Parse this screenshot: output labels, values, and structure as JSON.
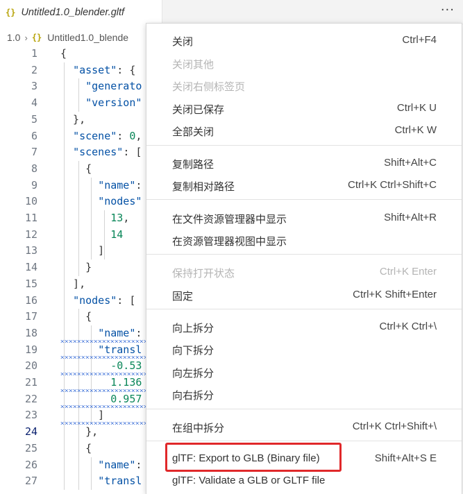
{
  "tab": {
    "icon": "{}",
    "title": "Untitled1.0_blender.gltf",
    "more": "···"
  },
  "breadcrumb": {
    "folder": "1.0",
    "chevron": "›",
    "icon": "{}",
    "file": "Untitled1.0_blende"
  },
  "editor": {
    "active_line": 24,
    "lines": [
      {
        "n": "1",
        "t": [
          [
            "p",
            "{"
          ]
        ]
      },
      {
        "n": "2",
        "t": [
          [
            "p",
            "  "
          ],
          [
            "k",
            "\"asset\""
          ],
          [
            "p",
            ": {"
          ]
        ]
      },
      {
        "n": "3",
        "t": [
          [
            "p",
            "    "
          ],
          [
            "k",
            "\"generato"
          ]
        ]
      },
      {
        "n": "4",
        "t": [
          [
            "p",
            "    "
          ],
          [
            "k",
            "\"version\""
          ]
        ]
      },
      {
        "n": "5",
        "t": [
          [
            "p",
            "  },"
          ]
        ]
      },
      {
        "n": "6",
        "t": [
          [
            "p",
            "  "
          ],
          [
            "k",
            "\"scene\""
          ],
          [
            "p",
            ": "
          ],
          [
            "n",
            "0"
          ],
          [
            "p",
            ","
          ]
        ]
      },
      {
        "n": "7",
        "t": [
          [
            "p",
            "  "
          ],
          [
            "k",
            "\"scenes\""
          ],
          [
            "p",
            ": ["
          ]
        ]
      },
      {
        "n": "8",
        "t": [
          [
            "p",
            "    {"
          ]
        ]
      },
      {
        "n": "9",
        "t": [
          [
            "p",
            "      "
          ],
          [
            "k",
            "\"name\""
          ],
          [
            "p",
            ":"
          ]
        ]
      },
      {
        "n": "10",
        "t": [
          [
            "p",
            "      "
          ],
          [
            "k",
            "\"nodes\""
          ]
        ]
      },
      {
        "n": "11",
        "t": [
          [
            "p",
            "        "
          ],
          [
            "n",
            "13"
          ],
          [
            "p",
            ","
          ]
        ]
      },
      {
        "n": "12",
        "t": [
          [
            "p",
            "        "
          ],
          [
            "n",
            "14"
          ]
        ]
      },
      {
        "n": "13",
        "t": [
          [
            "p",
            "      ]"
          ]
        ]
      },
      {
        "n": "14",
        "t": [
          [
            "p",
            "    }"
          ]
        ]
      },
      {
        "n": "15",
        "t": [
          [
            "p",
            "  ],"
          ]
        ]
      },
      {
        "n": "16",
        "t": [
          [
            "p",
            "  "
          ],
          [
            "k",
            "\"nodes\""
          ],
          [
            "p",
            ": ["
          ]
        ]
      },
      {
        "n": "17",
        "t": [
          [
            "p",
            "    {"
          ]
        ]
      },
      {
        "n": "18",
        "t": [
          [
            "p",
            "      "
          ],
          [
            "k",
            "\"name\""
          ],
          [
            "p",
            ":"
          ]
        ]
      },
      {
        "n": "19",
        "t": [
          [
            "p",
            "      "
          ],
          [
            "k",
            "\"transl"
          ]
        ]
      },
      {
        "n": "20",
        "t": [
          [
            "p",
            "        "
          ],
          [
            "n",
            "-0.53"
          ]
        ]
      },
      {
        "n": "21",
        "t": [
          [
            "p",
            "        "
          ],
          [
            "n",
            "1.136"
          ]
        ]
      },
      {
        "n": "22",
        "t": [
          [
            "p",
            "        "
          ],
          [
            "n",
            "0.957"
          ]
        ]
      },
      {
        "n": "23",
        "t": [
          [
            "p",
            "      ]"
          ]
        ]
      },
      {
        "n": "24",
        "t": [
          [
            "p",
            "    },"
          ]
        ]
      },
      {
        "n": "25",
        "t": [
          [
            "p",
            "    {"
          ]
        ]
      },
      {
        "n": "26",
        "t": [
          [
            "p",
            "      "
          ],
          [
            "k",
            "\"name\""
          ],
          [
            "p",
            ":"
          ]
        ]
      },
      {
        "n": "27",
        "t": [
          [
            "p",
            "      "
          ],
          [
            "k",
            "\"transl"
          ]
        ]
      }
    ]
  },
  "menu": {
    "items": [
      {
        "label": "关闭",
        "shortcut": "Ctrl+F4",
        "disabled": false
      },
      {
        "label": "关闭其他",
        "shortcut": "",
        "disabled": true
      },
      {
        "label": "关闭右侧标签页",
        "shortcut": "",
        "disabled": true
      },
      {
        "label": "关闭已保存",
        "shortcut": "Ctrl+K U",
        "disabled": false
      },
      {
        "label": "全部关闭",
        "shortcut": "Ctrl+K W",
        "disabled": false
      },
      {
        "label": "复制路径",
        "shortcut": "Shift+Alt+C",
        "disabled": false
      },
      {
        "label": "复制相对路径",
        "shortcut": "Ctrl+K Ctrl+Shift+C",
        "disabled": false
      },
      {
        "label": "在文件资源管理器中显示",
        "shortcut": "Shift+Alt+R",
        "disabled": false
      },
      {
        "label": "在资源管理器视图中显示",
        "shortcut": "",
        "disabled": false
      },
      {
        "label": "保持打开状态",
        "shortcut": "Ctrl+K Enter",
        "disabled": true
      },
      {
        "label": "固定",
        "shortcut": "Ctrl+K Shift+Enter",
        "disabled": false
      },
      {
        "label": "向上拆分",
        "shortcut": "Ctrl+K Ctrl+\\",
        "disabled": false
      },
      {
        "label": "向下拆分",
        "shortcut": "",
        "disabled": false
      },
      {
        "label": "向左拆分",
        "shortcut": "",
        "disabled": false
      },
      {
        "label": "向右拆分",
        "shortcut": "",
        "disabled": false
      },
      {
        "label": "在组中拆分",
        "shortcut": "Ctrl+K Ctrl+Shift+\\",
        "disabled": false
      },
      {
        "label": "glTF: Export to GLB (Binary file)",
        "shortcut": "Shift+Alt+S E",
        "disabled": false
      },
      {
        "label": "glTF: Validate a GLB or GLTF file",
        "shortcut": "",
        "disabled": false
      }
    ]
  },
  "colors": {
    "json_key": "#0451a5",
    "number": "#098658",
    "highlight_box": "#e0282a",
    "squiggle": "#3b6fd8"
  }
}
